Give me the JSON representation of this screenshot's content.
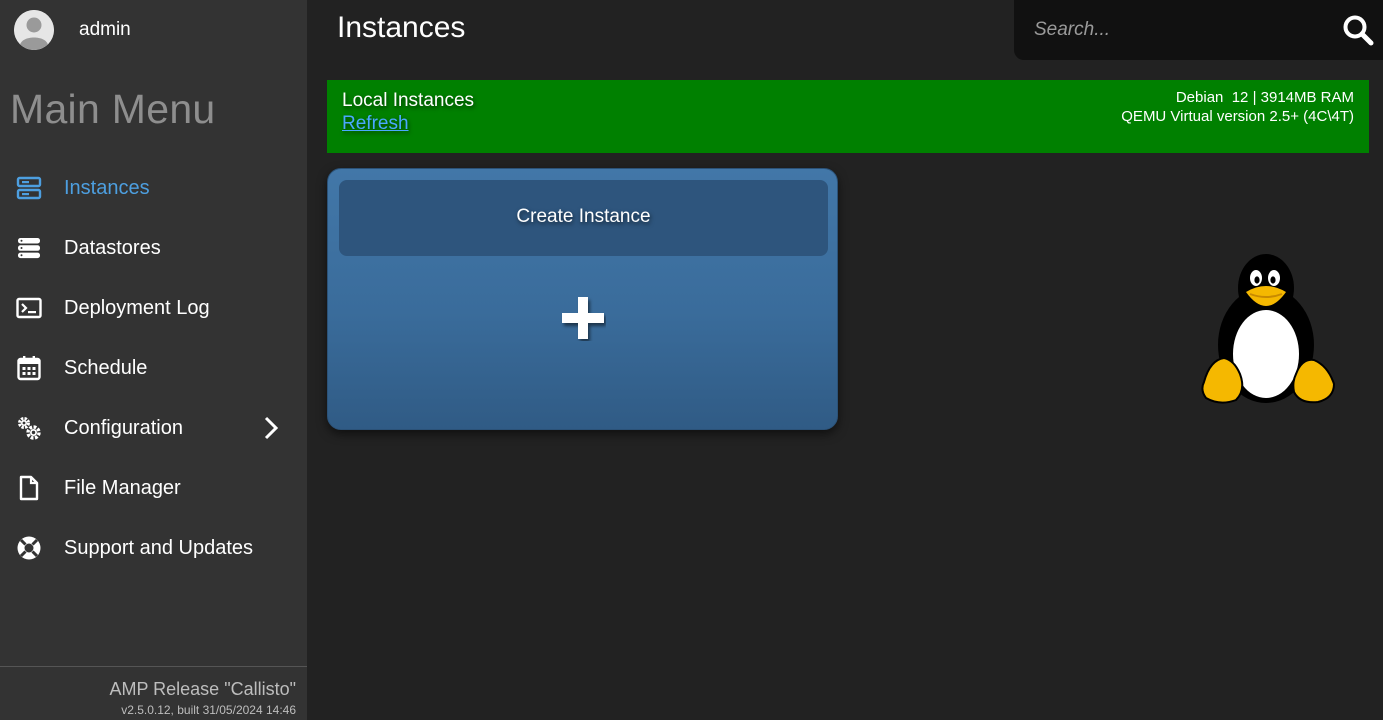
{
  "user": {
    "name": "admin"
  },
  "sidebar": {
    "title": "Main Menu",
    "items": [
      {
        "label": "Instances",
        "icon": "server-icon",
        "active": true
      },
      {
        "label": "Datastores",
        "icon": "database-icon"
      },
      {
        "label": "Deployment Log",
        "icon": "terminal-icon"
      },
      {
        "label": "Schedule",
        "icon": "calendar-icon"
      },
      {
        "label": "Configuration",
        "icon": "gears-icon",
        "has_submenu": true
      },
      {
        "label": "File Manager",
        "icon": "file-icon"
      },
      {
        "label": "Support and Updates",
        "icon": "lifebuoy-icon"
      }
    ],
    "footer": {
      "release": "AMP Release \"Callisto\"",
      "build": "v2.5.0.12, built 31/05/2024 14:46"
    }
  },
  "header": {
    "title": "Instances",
    "search": {
      "placeholder": "Search...",
      "value": ""
    }
  },
  "banner": {
    "title": "Local Instances",
    "refresh_label": "Refresh",
    "system_line1": "Debian  12 | 3914MB RAM",
    "system_line2": "QEMU Virtual version 2.5+ (4C\\4T)",
    "color": "#008000"
  },
  "create_card": {
    "label": "Create Instance",
    "icon": "plus-icon"
  },
  "os_logo": {
    "icon": "tux-icon"
  },
  "colors": {
    "background": "#222222",
    "sidebar": "#333333",
    "accent": "#4d9fe0",
    "card": "#3a6c9b"
  }
}
